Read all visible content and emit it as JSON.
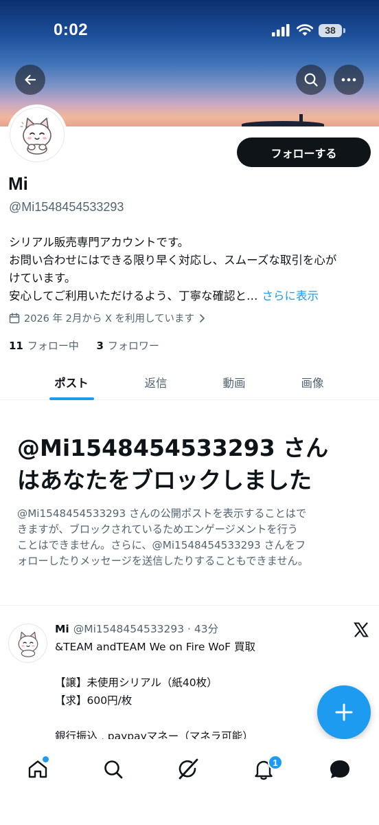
{
  "status_bar": {
    "time": "0:02",
    "battery": "38"
  },
  "header": {
    "back_icon": "arrow-left-icon",
    "search_icon": "search-icon",
    "more_icon": "more-horizontal-icon"
  },
  "profile": {
    "name": "Mi",
    "handle": "@Mi1548454533293",
    "follow_label": "フォローする",
    "bio_lines": [
      "シリアル販売専門アカウントです。",
      "お問い合わせにはできる限り早く対応し、スムーズな取引を心が",
      "けています。",
      "安心してご利用いただけるよう、丁寧な確認と…"
    ],
    "show_more": "さらに表示",
    "joined": "2026 年 2月から X を利用しています",
    "following_count": "11",
    "following_label": "フォロー中",
    "followers_count": "3",
    "followers_label": "フォロワー"
  },
  "tabs": [
    "ポスト",
    "返信",
    "動画",
    "画像"
  ],
  "active_tab": 0,
  "blocked": {
    "title_lines": [
      "@Mi1548454533293 さん",
      "はあなたをブロックしました"
    ],
    "desc_lines": [
      "@Mi1548454533293 さんの公開ポストを表示することはで",
      "きますが、ブロックされているためエンゲージメントを行う",
      "ことはできません。さらに、@Mi1548454533293 さんをフ",
      "ォローしたりメッセージを送信したりすることもできません。"
    ]
  },
  "post": {
    "name": "Mi",
    "meta": "@Mi1548454533293 · 43分",
    "lines": [
      "&TEAM andTEAM We on Fire WoF 買取",
      "",
      "【譲】未使用シリアル（紙40枚）",
      "【求】600円/枚",
      "",
      "銀行振込 , paypayマネー（マネラ可能）"
    ]
  },
  "bottom_nav": {
    "items": [
      "home-icon",
      "search-icon",
      "grok-icon",
      "bell-icon",
      "chat-icon"
    ],
    "notification_badge": "1"
  },
  "colors": {
    "accent": "#1d9bf0",
    "text": "#0f1419",
    "secondary_text": "#536471"
  }
}
